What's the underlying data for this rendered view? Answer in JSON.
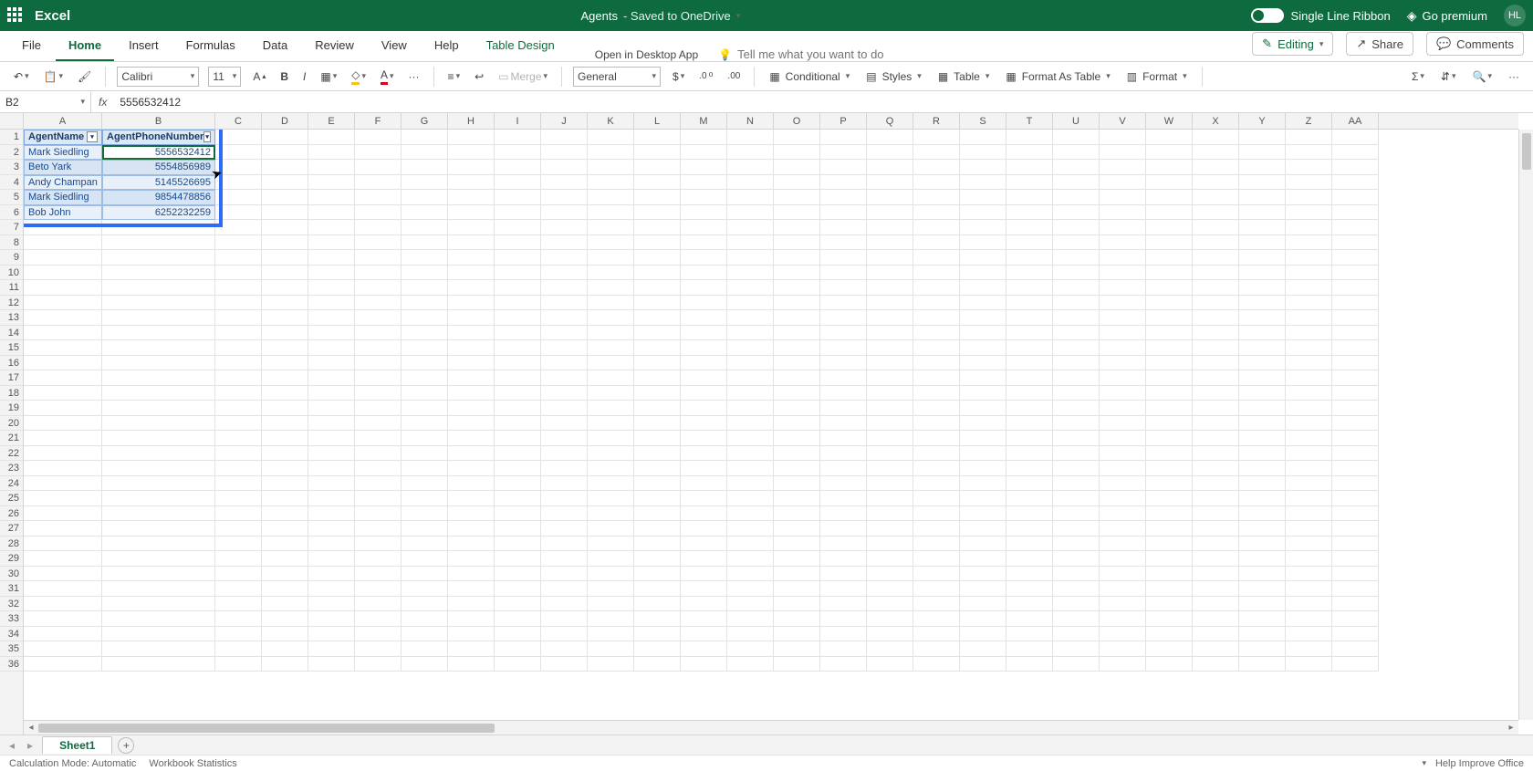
{
  "app_name": "Excel",
  "doc": {
    "title": "Agents",
    "saved": "Saved to OneDrive"
  },
  "title_right": {
    "single_line_ribbon": "Single Line Ribbon",
    "go_premium": "Go premium",
    "user_initials": "HL"
  },
  "tabs": {
    "file": "File",
    "home": "Home",
    "insert": "Insert",
    "formulas": "Formulas",
    "data": "Data",
    "review": "Review",
    "view": "View",
    "help": "Help",
    "table_design": "Table Design"
  },
  "ribbon_extras": {
    "open_desktop": "Open in Desktop App",
    "tell_me_placeholder": "Tell me what you want to do",
    "editing": "Editing",
    "share": "Share",
    "comments": "Comments"
  },
  "toolbar": {
    "font_name": "Calibri",
    "font_size": "11",
    "merge": "Merge",
    "number_format": "General",
    "conditional": "Conditional",
    "styles": "Styles",
    "table": "Table",
    "format_as_table": "Format As Table",
    "format": "Format"
  },
  "formula_bar": {
    "name_box": "B2",
    "formula": "5556532412"
  },
  "columns": [
    "A",
    "B",
    "C",
    "D",
    "E",
    "F",
    "G",
    "H",
    "I",
    "J",
    "K",
    "L",
    "M",
    "N",
    "O",
    "P",
    "Q",
    "R",
    "S",
    "T",
    "U",
    "V",
    "W",
    "X",
    "Y",
    "Z",
    "AA"
  ],
  "col_widths": {
    "A": 86,
    "B": 124,
    "default": 51
  },
  "row_count": 36,
  "table": {
    "headers": [
      "AgentName",
      "AgentPhoneNumber"
    ],
    "rows": [
      [
        "Mark Siedling",
        "5556532412"
      ],
      [
        "Beto Yark",
        "5554856989"
      ],
      [
        "Andy Champan",
        "5145526695"
      ],
      [
        "Mark Siedling",
        "9854478856"
      ],
      [
        "Bob John",
        "6252232259"
      ]
    ]
  },
  "sheet": {
    "name": "Sheet1"
  },
  "status": {
    "calc_mode": "Calculation Mode: Automatic",
    "wb_stats": "Workbook Statistics",
    "help_improve": "Help Improve Office"
  }
}
